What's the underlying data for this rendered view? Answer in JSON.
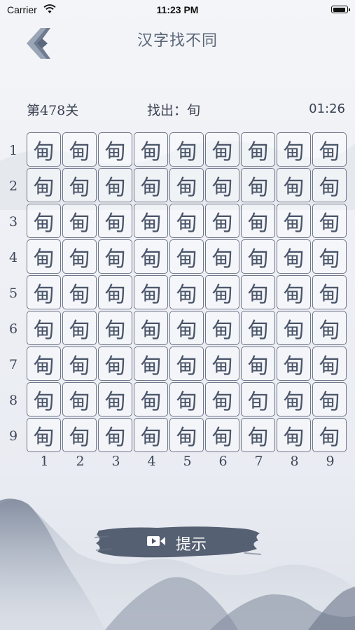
{
  "status_bar": {
    "carrier": "Carrier",
    "time": "11:23 PM",
    "battery_level": 0.95
  },
  "header": {
    "title": "汉字找不同",
    "back_icon": "back-arrow-icon"
  },
  "info": {
    "level": "第478关",
    "target": "找出：旬",
    "timer": "01:26"
  },
  "grid": {
    "rows": [
      [
        "甸",
        "甸",
        "甸",
        "甸",
        "甸",
        "甸",
        "甸",
        "甸",
        "甸"
      ],
      [
        "甸",
        "甸",
        "甸",
        "甸",
        "甸",
        "甸",
        "甸",
        "甸",
        "甸"
      ],
      [
        "甸",
        "甸",
        "甸",
        "甸",
        "甸",
        "甸",
        "甸",
        "甸",
        "甸"
      ],
      [
        "甸",
        "甸",
        "甸",
        "甸",
        "甸",
        "甸",
        "甸",
        "甸",
        "甸"
      ],
      [
        "甸",
        "甸",
        "甸",
        "甸",
        "甸",
        "甸",
        "甸",
        "甸",
        "甸"
      ],
      [
        "甸",
        "甸",
        "甸",
        "甸",
        "甸",
        "甸",
        "甸",
        "甸",
        "甸"
      ],
      [
        "甸",
        "甸",
        "甸",
        "甸",
        "甸",
        "甸",
        "甸",
        "甸",
        "甸"
      ],
      [
        "甸",
        "甸",
        "甸",
        "甸",
        "甸",
        "甸",
        "旬",
        "甸",
        "甸"
      ],
      [
        "甸",
        "甸",
        "甸",
        "甸",
        "甸",
        "甸",
        "甸",
        "甸",
        "甸"
      ]
    ],
    "row_labels": [
      "1",
      "2",
      "3",
      "4",
      "5",
      "6",
      "7",
      "8",
      "9"
    ],
    "col_labels": [
      "1",
      "2",
      "3",
      "4",
      "5",
      "6",
      "7",
      "8",
      "9"
    ]
  },
  "hint": {
    "label": "提示",
    "icon": "video-camera-icon",
    "brush_color": "#4a5468"
  },
  "colors": {
    "accent": "#5a6678",
    "cell_border": "#6f7689",
    "text": "#3b4252"
  }
}
